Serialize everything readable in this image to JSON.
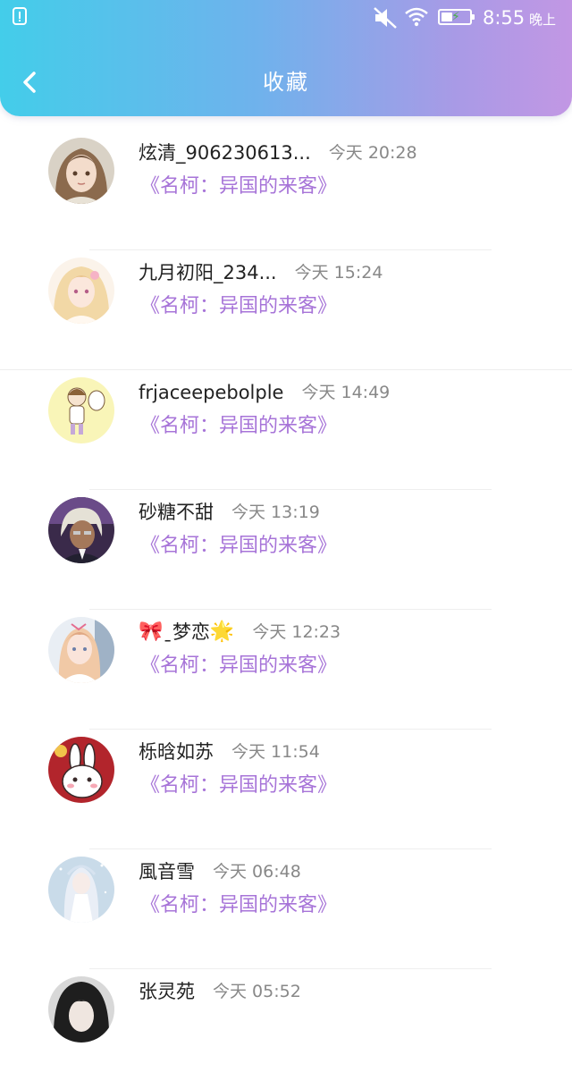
{
  "status_bar": {
    "time": "8:55",
    "ampm": "晚上",
    "battery_level": 0.35,
    "icons": [
      "notification-alert-icon",
      "mute-icon",
      "wifi-icon",
      "battery-charging-icon"
    ]
  },
  "header": {
    "title": "收藏",
    "back_icon": "chevron-left-icon"
  },
  "colors": {
    "header_gradient_start": "#43cdea",
    "header_gradient_end": "#c297e4",
    "book_title": "#a774d8",
    "username": "#222222",
    "timestamp": "#888888"
  },
  "favorites": [
    {
      "user": "炫清_906230613...",
      "time": "今天  20:28",
      "book": "《名柯：异国的来客》",
      "avatar_icon": "avatar-anime-girl-brown-hair"
    },
    {
      "user": "九月初阳_234...",
      "time": "今天  15:24",
      "book": "《名柯：异国的来客》",
      "avatar_icon": "avatar-anime-girl-blonde"
    },
    {
      "user": "frjaceepebolple",
      "time": "今天  14:49",
      "book": "《名柯：异国的来客》",
      "avatar_icon": "avatar-chibi-yellow"
    },
    {
      "user": "砂糖不甜",
      "time": "今天  13:19",
      "book": "《名柯：异国的来客》",
      "avatar_icon": "avatar-anime-boy-dark"
    },
    {
      "user_prefix": "🎀",
      "user": "ˍ梦恋",
      "user_suffix": "🌟",
      "time": "今天  12:23",
      "book": "《名柯：异国的来客》",
      "avatar_icon": "avatar-anime-girl-white"
    },
    {
      "user": "栎晗如苏",
      "time": "今天  11:54",
      "book": "《名柯：异国的来客》",
      "avatar_icon": "avatar-white-rabbit"
    },
    {
      "user": "風音雪",
      "time": "今天  06:48",
      "book": "《名柯：异国的来客》",
      "avatar_icon": "avatar-anime-girl-silver"
    },
    {
      "user": "张灵苑",
      "time": "今天  05:52",
      "book": "",
      "avatar_icon": "avatar-dark-hair"
    }
  ]
}
